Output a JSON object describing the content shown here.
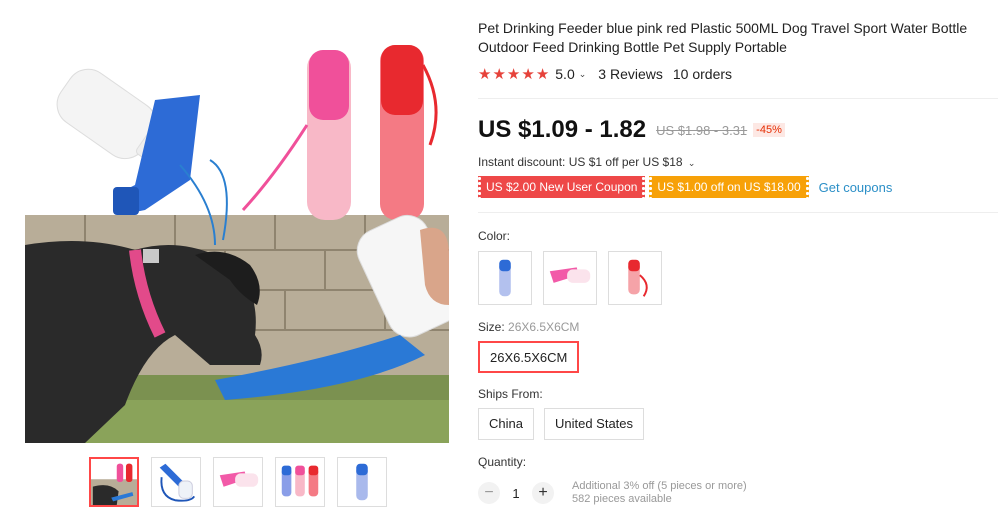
{
  "product": {
    "title": "Pet Drinking Feeder blue pink red Plastic 500ML Dog Travel Sport Water Bottle Outdoor Feed Drinking Bottle Pet Supply Portable",
    "rating": "5.0",
    "reviews": "3 Reviews",
    "orders": "10 orders",
    "price": "US $1.09 - 1.82",
    "original_price": "US $1.98 - 3.31",
    "discount": "-45%",
    "instant_discount": "Instant discount: US $1 off per US $18"
  },
  "coupons": {
    "new_user": "US $2.00 New User Coupon",
    "off": "US $1.00 off on US $18.00",
    "get": "Get coupons"
  },
  "options": {
    "color_label": "Color:",
    "size_label": "Size:",
    "size_selected": "26X6.5X6CM",
    "size_value": "26X6.5X6CM",
    "ships_label": "Ships From:",
    "ships": [
      "China",
      "United States"
    ],
    "colors": [
      "blue",
      "pink",
      "red"
    ]
  },
  "quantity": {
    "label": "Quantity:",
    "value": "1",
    "minus": "−",
    "plus": "+",
    "note1": "Additional 3% off (5 pieces or more)",
    "note2": "582 pieces available"
  },
  "icons": {
    "star": "star-icon",
    "chevron": "chevron-down-icon"
  },
  "colors": {
    "accent": "#ff4747",
    "star": "#e6423a",
    "coupon_red": "#ee4848",
    "coupon_orange": "#f7a108",
    "link": "#2b8fc7"
  }
}
